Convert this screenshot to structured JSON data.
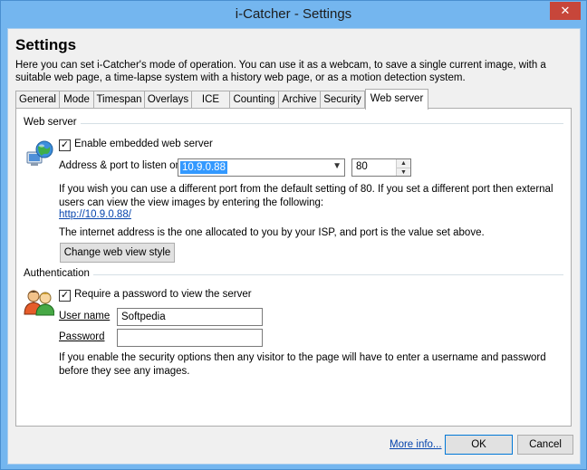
{
  "window": {
    "title": "i-Catcher - Settings",
    "close_glyph": "✕"
  },
  "header": {
    "heading": "Settings",
    "intro": "Here you can set i-Catcher's mode of operation. You can use it as a webcam, to save a single current image, with a suitable web page, a time-lapse system with a history web page, or as a motion detection system."
  },
  "tabs": [
    {
      "label": "General"
    },
    {
      "label": "Mode"
    },
    {
      "label": "Timespan"
    },
    {
      "label": "Overlays"
    },
    {
      "label": "ICE"
    },
    {
      "label": "Counting"
    },
    {
      "label": "Archive"
    },
    {
      "label": "Security"
    },
    {
      "label": "Web server",
      "active": true
    }
  ],
  "web_server": {
    "group_label": "Web server",
    "icon": "globe-computer-icon",
    "enable_checked": true,
    "enable_label": "Enable embedded web server",
    "address_label": "Address & port to listen on",
    "address_value": "10.9.0.88",
    "port_value": "80",
    "port_help": "If you wish you can use a different port from the default setting of 80. If you set a different port then external users can view the view images by entering the following:",
    "url": "http://10.9.0.88/",
    "internet_note": "The internet address is the one allocated to you by your ISP, and port is the value set above.",
    "change_style_label": "Change web view style"
  },
  "authentication": {
    "group_label": "Authentication",
    "icon": "users-icon",
    "require_checked": true,
    "require_label": "Require a password to view the server",
    "username_label": "User name",
    "username_value": "Softpedia",
    "password_label": "Password",
    "password_value": "",
    "note": "If you enable the security options then any visitor to the page will have to enter a username and password before they see any images."
  },
  "footer": {
    "more_info": "More info...",
    "ok": "OK",
    "cancel": "Cancel"
  },
  "colors": {
    "titlebar": "#74b6ef",
    "close_button": "#c7463a",
    "selection": "#3399ff",
    "link": "#0645ad"
  }
}
